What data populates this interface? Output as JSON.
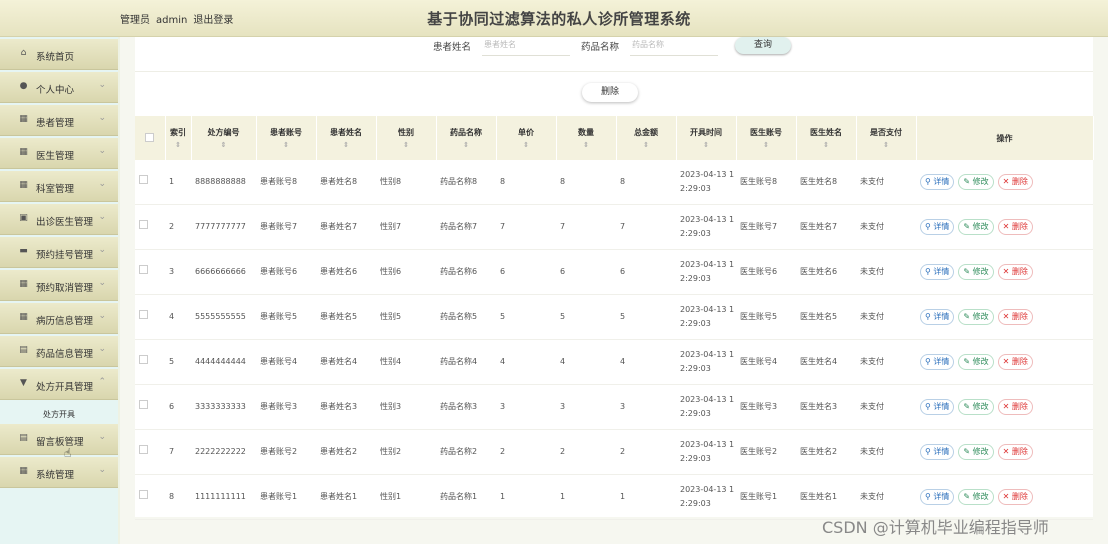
{
  "header": {
    "role": "管理员",
    "username": "admin",
    "logout": "退出登录",
    "title": "基于协同过滤算法的私人诊所管理系统"
  },
  "sidebar": {
    "items": [
      {
        "label": "系统首页",
        "icon": "home-icon",
        "glyph": "⌂",
        "chev": ""
      },
      {
        "label": "个人中心",
        "icon": "user-icon",
        "glyph": "●",
        "chev": "⌄"
      },
      {
        "label": "患者管理",
        "icon": "grid-icon",
        "glyph": "▦",
        "chev": "⌄"
      },
      {
        "label": "医生管理",
        "icon": "grid-icon",
        "glyph": "▦",
        "chev": "⌄"
      },
      {
        "label": "科室管理",
        "icon": "grid-icon",
        "glyph": "▦",
        "chev": "⌄"
      },
      {
        "label": "出诊医生管理",
        "icon": "briefcase-icon",
        "glyph": "▣",
        "chev": "⌄"
      },
      {
        "label": "预约挂号管理",
        "icon": "monitor-icon",
        "glyph": "▬",
        "chev": "⌄"
      },
      {
        "label": "预约取消管理",
        "icon": "grid-icon",
        "glyph": "▦",
        "chev": "⌄"
      },
      {
        "label": "病历信息管理",
        "icon": "grid-icon",
        "glyph": "▦",
        "chev": "⌄"
      },
      {
        "label": "药品信息管理",
        "icon": "clipboard-icon",
        "glyph": "▤",
        "chev": "⌄"
      },
      {
        "label": "处方开具管理",
        "icon": "bookmark-icon",
        "glyph": "▼",
        "chev": "⌃"
      }
    ],
    "submenu": "处方开具",
    "after": [
      {
        "label": "留言板管理",
        "icon": "clipboard-icon",
        "glyph": "▤",
        "chev": "⌄"
      },
      {
        "label": "系统管理",
        "icon": "grid-icon",
        "glyph": "▦",
        "chev": "⌄"
      }
    ]
  },
  "search": {
    "patient_label": "患者姓名",
    "patient_placeholder": "患者姓名",
    "drug_label": "药品名称",
    "drug_placeholder": "药品名称",
    "query": "查询"
  },
  "toolbar": {
    "delete": "删除"
  },
  "table": {
    "columns": [
      "",
      "索引",
      "处方编号",
      "患者账号",
      "患者姓名",
      "性别",
      "药品名称",
      "单价",
      "数量",
      "总金额",
      "开具时间",
      "医生账号",
      "医生姓名",
      "是否支付",
      "操作"
    ],
    "actions": {
      "view": "详情",
      "edit": "修改",
      "delete": "删除"
    },
    "rows": [
      {
        "index": "1",
        "code": "8888888888",
        "paccount": "患者账号8",
        "pname": "患者姓名8",
        "gender": "性别8",
        "drug": "药品名称8",
        "price": "8",
        "qty": "8",
        "total": "8",
        "time": "2023-04-13 12:29:03",
        "daccount": "医生账号8",
        "dname": "医生姓名8",
        "paid": "未支付"
      },
      {
        "index": "2",
        "code": "7777777777",
        "paccount": "患者账号7",
        "pname": "患者姓名7",
        "gender": "性别7",
        "drug": "药品名称7",
        "price": "7",
        "qty": "7",
        "total": "7",
        "time": "2023-04-13 12:29:03",
        "daccount": "医生账号7",
        "dname": "医生姓名7",
        "paid": "未支付"
      },
      {
        "index": "3",
        "code": "6666666666",
        "paccount": "患者账号6",
        "pname": "患者姓名6",
        "gender": "性别6",
        "drug": "药品名称6",
        "price": "6",
        "qty": "6",
        "total": "6",
        "time": "2023-04-13 12:29:03",
        "daccount": "医生账号6",
        "dname": "医生姓名6",
        "paid": "未支付"
      },
      {
        "index": "4",
        "code": "5555555555",
        "paccount": "患者账号5",
        "pname": "患者姓名5",
        "gender": "性别5",
        "drug": "药品名称5",
        "price": "5",
        "qty": "5",
        "total": "5",
        "time": "2023-04-13 12:29:03",
        "daccount": "医生账号5",
        "dname": "医生姓名5",
        "paid": "未支付"
      },
      {
        "index": "5",
        "code": "4444444444",
        "paccount": "患者账号4",
        "pname": "患者姓名4",
        "gender": "性别4",
        "drug": "药品名称4",
        "price": "4",
        "qty": "4",
        "total": "4",
        "time": "2023-04-13 12:29:03",
        "daccount": "医生账号4",
        "dname": "医生姓名4",
        "paid": "未支付"
      },
      {
        "index": "6",
        "code": "3333333333",
        "paccount": "患者账号3",
        "pname": "患者姓名3",
        "gender": "性别3",
        "drug": "药品名称3",
        "price": "3",
        "qty": "3",
        "total": "3",
        "time": "2023-04-13 12:29:03",
        "daccount": "医生账号3",
        "dname": "医生姓名3",
        "paid": "未支付"
      },
      {
        "index": "7",
        "code": "2222222222",
        "paccount": "患者账号2",
        "pname": "患者姓名2",
        "gender": "性别2",
        "drug": "药品名称2",
        "price": "2",
        "qty": "2",
        "total": "2",
        "time": "2023-04-13 12:29:03",
        "daccount": "医生账号2",
        "dname": "医生姓名2",
        "paid": "未支付"
      },
      {
        "index": "8",
        "code": "1111111111",
        "paccount": "患者账号1",
        "pname": "患者姓名1",
        "gender": "性别1",
        "drug": "药品名称1",
        "price": "1",
        "qty": "1",
        "total": "1",
        "time": "2023-04-13 12:29:03",
        "daccount": "医生账号1",
        "dname": "医生姓名1",
        "paid": "未支付"
      }
    ]
  },
  "watermark": "CSDN @计算机毕业编程指导师"
}
